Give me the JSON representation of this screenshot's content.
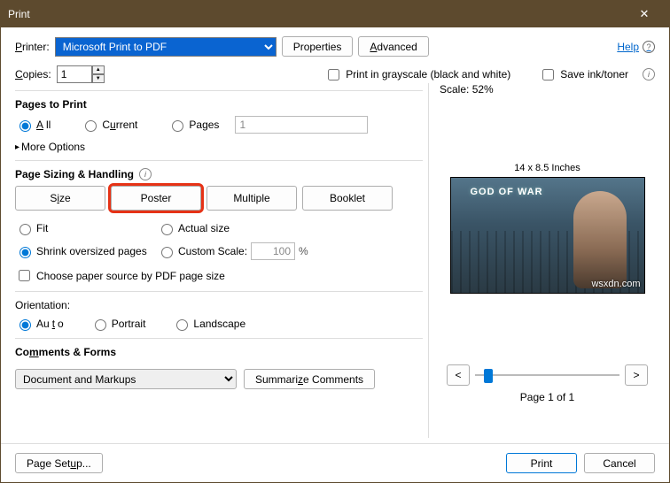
{
  "window": {
    "title": "Print"
  },
  "header": {
    "printer_label": "Printer:",
    "printer_value": "Microsoft Print to PDF",
    "properties_btn": "Properties",
    "advanced_btn": "Advanced",
    "help": "Help",
    "copies_label": "Copies:",
    "copies_value": "1",
    "grayscale": "Print in grayscale (black and white)",
    "save_ink": "Save ink/toner"
  },
  "pages_to_print": {
    "title": "Pages to Print",
    "all": "All",
    "current": "Current",
    "pages": "Pages",
    "pages_value": "1",
    "more_options": "More Options"
  },
  "sizing": {
    "title": "Page Sizing & Handling",
    "size": "Size",
    "poster": "Poster",
    "multiple": "Multiple",
    "booklet": "Booklet",
    "fit": "Fit",
    "actual": "Actual size",
    "shrink": "Shrink oversized pages",
    "custom": "Custom Scale:",
    "custom_value": "100",
    "custom_pct": "%",
    "choose_source": "Choose paper source by PDF page size"
  },
  "orientation": {
    "title": "Orientation:",
    "auto": "Auto",
    "portrait": "Portrait",
    "landscape": "Landscape"
  },
  "comments": {
    "title": "Comments & Forms",
    "value": "Document and Markups",
    "summarize": "Summarize Comments"
  },
  "preview": {
    "scale_label": "Scale:",
    "scale_value": "52%",
    "dimensions": "14 x 8.5 Inches",
    "logo": "GOD OF WAR",
    "watermark": "wsxdn.com",
    "prev": "<",
    "next": ">",
    "page_of": "Page 1 of 1"
  },
  "footer": {
    "page_setup": "Page Setup...",
    "print": "Print",
    "cancel": "Cancel"
  }
}
